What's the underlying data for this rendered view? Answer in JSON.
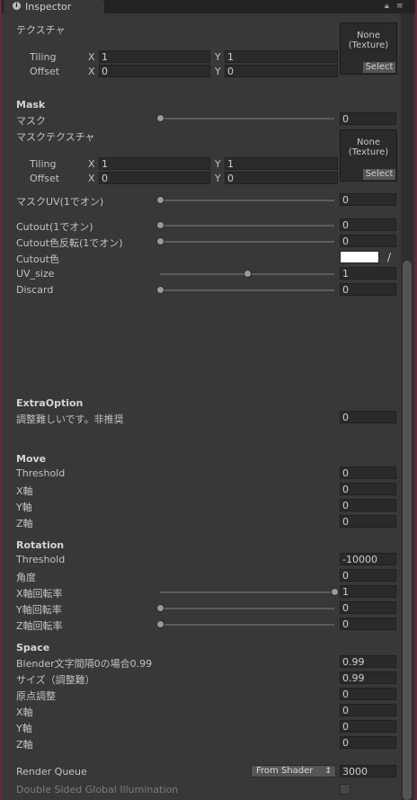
{
  "tab": {
    "title": "Inspector",
    "lock_icon": "lock-icon",
    "menu_icon": "menu-icon"
  },
  "texture": {
    "label": "テクスチャ",
    "none": "None",
    "type": "(Texture)",
    "select": "Select",
    "tiling_label": "Tiling",
    "tiling_x": "1",
    "tiling_y": "1",
    "offset_label": "Offset",
    "offset_x": "0",
    "offset_y": "0",
    "x_label": "X",
    "y_label": "Y"
  },
  "mask": {
    "header": "Mask",
    "mask_label": "マスク",
    "mask_value": "0",
    "mask_slider": 0,
    "tex_label": "マスクテクスチャ",
    "none": "None",
    "type": "(Texture)",
    "select": "Select",
    "tiling_label": "Tiling",
    "tiling_x": "1",
    "tiling_y": "1",
    "offset_label": "Offset",
    "offset_x": "0",
    "offset_y": "0",
    "x_label": "X",
    "y_label": "Y",
    "uv_label": "マスクUV(1でオン)",
    "uv_value": "0",
    "uv_slider": 0
  },
  "cutout": {
    "cutout_label": "Cutout(1でオン)",
    "cutout_value": "0",
    "cutout_slider": 0,
    "invert_label": "Cutout色反転(1でオン)",
    "invert_value": "0",
    "invert_slider": 0,
    "color_label": "Cutout色",
    "color": "#ffffff",
    "uvsize_label": "UV_size",
    "uvsize_value": "1",
    "uvsize_slider": 0.5,
    "discard_label": "Discard",
    "discard_value": "0",
    "discard_slider": 0
  },
  "extra": {
    "header": "ExtraOption",
    "label": "調整難しいです。非推奨",
    "value": "0"
  },
  "move": {
    "header": "Move",
    "threshold_label": "Threshold",
    "threshold_value": "0",
    "x_label": "X軸",
    "x_value": "0",
    "y_label": "Y軸",
    "y_value": "0",
    "z_label": "Z軸",
    "z_value": "0"
  },
  "rotation": {
    "header": "Rotation",
    "threshold_label": "Threshold",
    "threshold_value": "-10000",
    "angle_label": "角度",
    "angle_value": "0",
    "x_label": "X軸回転率",
    "x_value": "1",
    "x_slider": 1,
    "y_label": "Y軸回転率",
    "y_value": "0",
    "y_slider": 0,
    "z_label": "Z軸回転率",
    "z_value": "0",
    "z_slider": 0
  },
  "space": {
    "header": "Space",
    "blender_label": "Blender文字間隔0の場合0.99",
    "blender_value": "0.99",
    "size_label": "サイズ（調整難）",
    "size_value": "0.99",
    "origin_label": "原点調整",
    "origin_value": "0",
    "x_label": "X軸",
    "x_value": "0",
    "y_label": "Y軸",
    "y_value": "0",
    "z_label": "Z軸",
    "z_value": "0"
  },
  "render": {
    "queue_label": "Render Queue",
    "queue_mode": "From Shader",
    "queue_value": "3000",
    "dsgi_label": "Double Sided Global Illumination"
  }
}
